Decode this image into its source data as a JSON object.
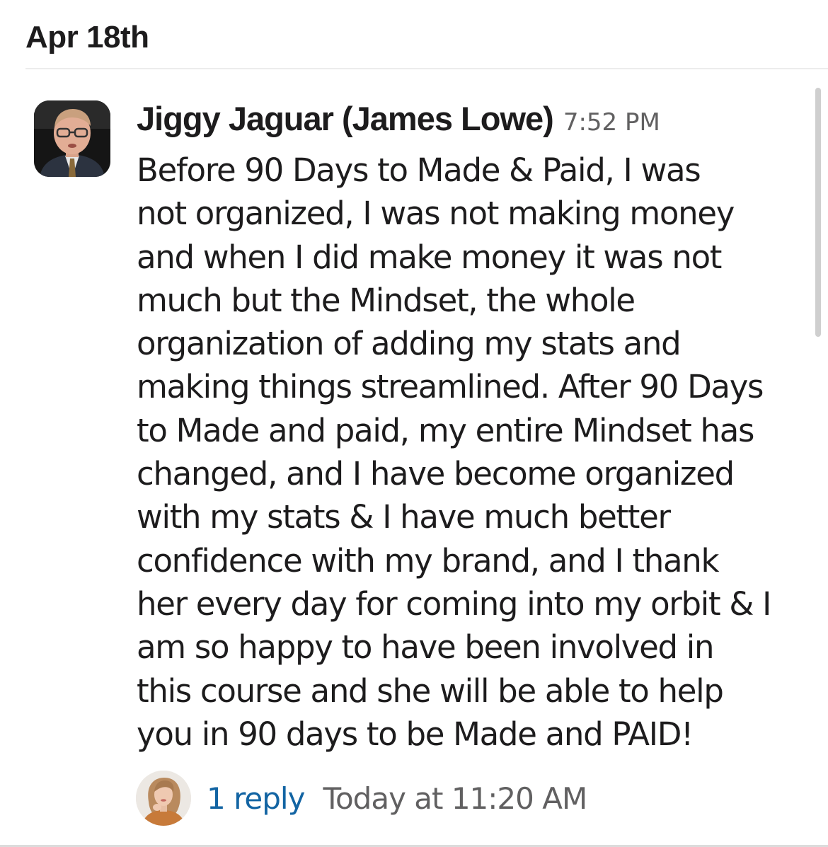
{
  "date_divider": {
    "label": "Apr 18th"
  },
  "message": {
    "author": "Jiggy Jaguar (James Lowe)",
    "time": "7:52 PM",
    "avatar_icon": "person-photo-icon",
    "body_lines": [
      "Before 90 Days to Made & Paid, I was",
      "not organized, I was not making money",
      "and when I did make money it was not",
      "much but the Mindset, the whole",
      "organization of adding my stats and",
      "making things streamlined. After 90 Days",
      "to Made and paid, my entire Mindset has",
      "changed, and I have become organized",
      "with my stats & I have much better",
      "confidence with my brand, and I thank",
      "her every day for coming into my orbit & I",
      "am so happy to have been involved in",
      "this course and she will be able to help",
      "you in 90 days to be Made and PAID!"
    ]
  },
  "thread": {
    "reply_count_label": "1 reply",
    "last_reply_time": "Today at 11:20 AM",
    "replier_avatar_icon": "person-photo-icon"
  },
  "colors": {
    "link": "#1264a3",
    "muted": "#616061",
    "text": "#1d1c1d"
  }
}
